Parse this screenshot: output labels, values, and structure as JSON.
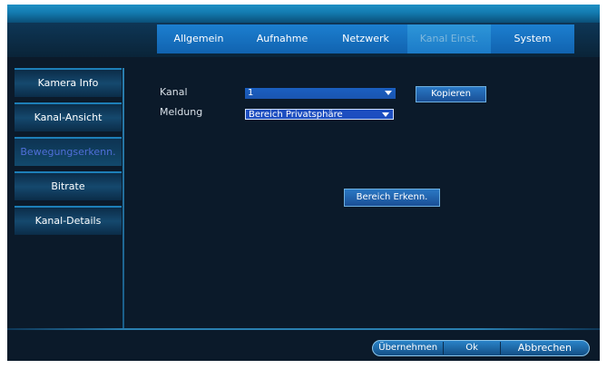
{
  "tabs": [
    {
      "label": "Allgemein"
    },
    {
      "label": "Aufnahme"
    },
    {
      "label": "Netzwerk"
    },
    {
      "label": "Kanal Einst."
    },
    {
      "label": "System"
    }
  ],
  "active_tab": "Kanal Einst.",
  "sidebar": {
    "items": [
      {
        "label": "Kamera Info"
      },
      {
        "label": "Kanal-Ansicht"
      },
      {
        "label": "Bewegungserkenn."
      },
      {
        "label": "Bitrate"
      },
      {
        "label": "Kanal-Details"
      }
    ],
    "active": "Bewegungserkenn."
  },
  "form": {
    "kanal_label": "Kanal",
    "kanal_value": "1",
    "meldung_label": "Meldung",
    "meldung_value": "Bereich Privatsphäre",
    "copy_button": "Kopieren",
    "area_button": "Bereich Erkenn."
  },
  "footer": {
    "apply": "Übernehmen",
    "ok": "Ok",
    "cancel": "Abbrechen"
  },
  "colors": {
    "tab_blue": "#1c7fd0",
    "screen_bg": "#0b1a2a",
    "active_text": "#4f6fd8"
  }
}
